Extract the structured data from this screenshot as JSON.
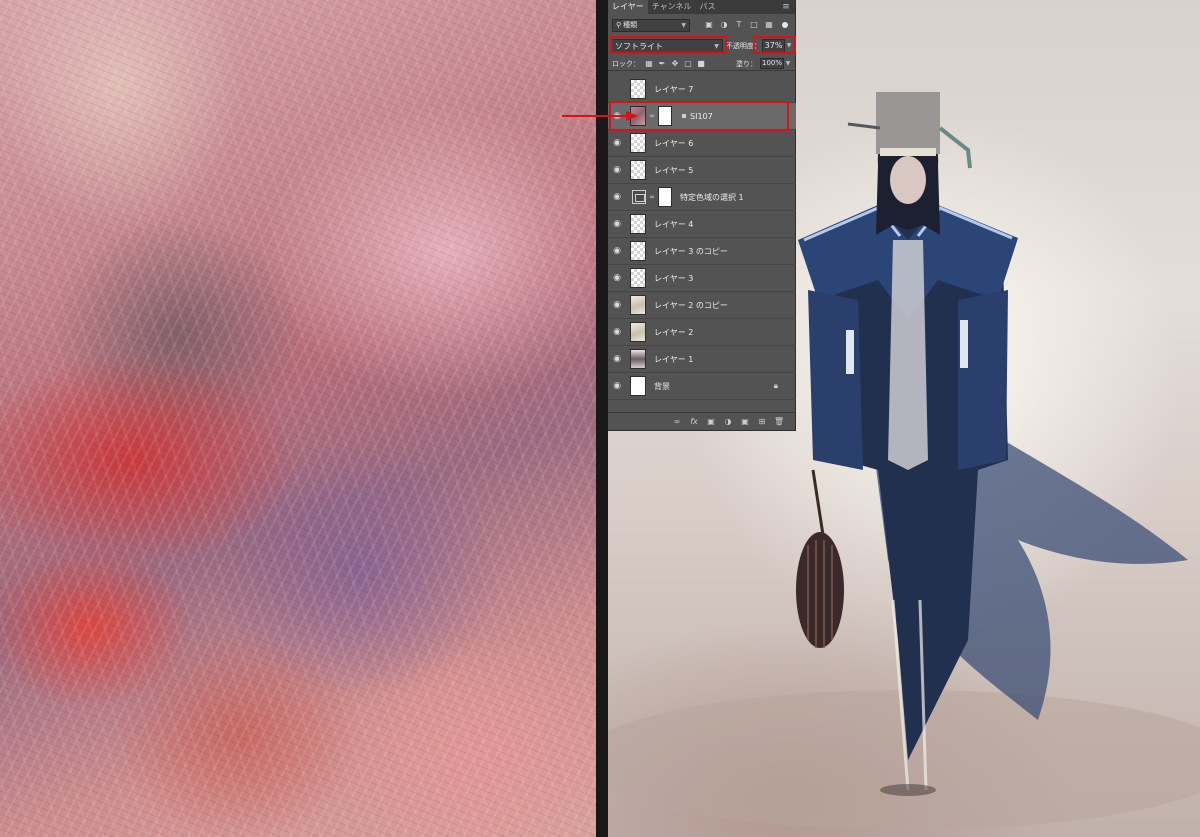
{
  "panel": {
    "tabs": [
      {
        "label": "レイヤー",
        "active": true
      },
      {
        "label": "チャンネル",
        "active": false
      },
      {
        "label": "パス",
        "active": false
      }
    ],
    "menu_icon": "hamburger-icon",
    "filter": {
      "label": "種類",
      "icons": [
        "image-filter-icon",
        "adjustment-filter-icon",
        "type-filter-icon",
        "shape-filter-icon",
        "smart-object-filter-icon"
      ]
    },
    "blend_mode": "ソフトライト",
    "opacity_label": "不透明度：",
    "opacity_value": "37%",
    "lock_label": "ロック：",
    "lock_icons": [
      "lock-transparency-icon",
      "lock-pixels-icon",
      "lock-position-icon",
      "lock-artboard-icon",
      "lock-all-icon"
    ],
    "fill_label": "塗り：",
    "fill_value": "100%",
    "layers": [
      {
        "name": "レイヤー 7",
        "visible": false
      },
      {
        "name": "SI107",
        "visible": true,
        "selected": true,
        "has_mask": true
      },
      {
        "name": "レイヤー 6",
        "visible": true
      },
      {
        "name": "レイヤー 5",
        "visible": true
      },
      {
        "name": "特定色域の選択 1",
        "visible": true,
        "adjustment": true,
        "has_mask": true
      },
      {
        "name": "レイヤー 4",
        "visible": true
      },
      {
        "name": "レイヤー 3 のコピー",
        "visible": true
      },
      {
        "name": "レイヤー 3",
        "visible": true
      },
      {
        "name": "レイヤー 2 のコピー",
        "visible": true
      },
      {
        "name": "レイヤー 2",
        "visible": true
      },
      {
        "name": "レイヤー 1",
        "visible": true
      },
      {
        "name": "背景",
        "visible": true,
        "locked": true
      }
    ],
    "footer_icons": [
      "link-layers-icon",
      "fx-icon",
      "add-mask-icon",
      "adjustment-layer-icon",
      "new-group-icon",
      "new-layer-icon",
      "trash-icon"
    ]
  },
  "colors": {
    "highlight": "#d3141a",
    "panel_bg": "#535353",
    "selected_row": "#6a6a6a"
  }
}
